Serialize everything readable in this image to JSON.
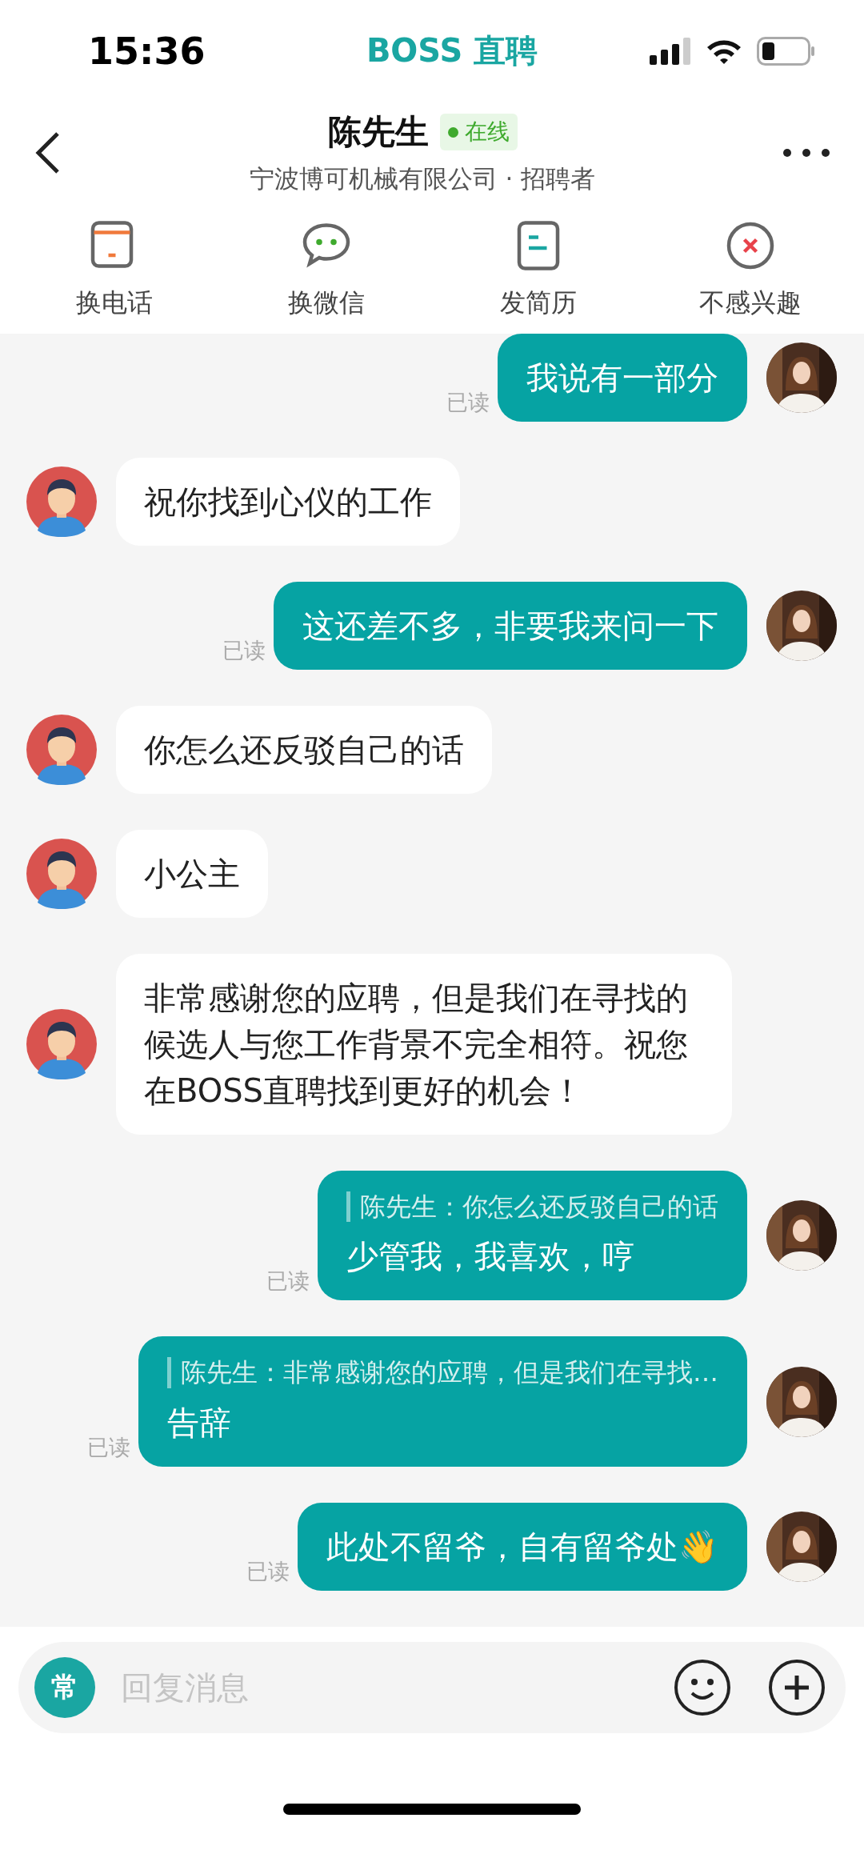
{
  "status_bar": {
    "time": "15:36",
    "app": "BOSS 直聘"
  },
  "header": {
    "name": "陈先生",
    "presence": {
      "label": "在线",
      "online": true
    },
    "subtitle": "宁波博可机械有限公司 · 招聘者"
  },
  "actions": [
    {
      "kind": "phone",
      "label": "换电话"
    },
    {
      "kind": "wechat",
      "label": "换微信"
    },
    {
      "kind": "resume",
      "label": "发简历"
    },
    {
      "kind": "reject",
      "label": "不感兴趣"
    }
  ],
  "messages": [
    {
      "kind": "sent",
      "text": "我说有一部分",
      "read": "已读"
    },
    {
      "kind": "received",
      "text": "祝你找到心仪的工作"
    },
    {
      "kind": "sent",
      "text": "这还差不多，非要我来问一下",
      "read": "已读"
    },
    {
      "kind": "received",
      "text": "你怎么还反驳自己的话"
    },
    {
      "kind": "received",
      "text": "小公主"
    },
    {
      "kind": "received",
      "text": "非常感谢您的应聘，但是我们在寻找的候选人与您工作背景不完全相符。祝您在BOSS直聘找到更好的机会！"
    },
    {
      "kind": "sent",
      "quote": "陈先生：你怎么还反驳自己的话",
      "text": "少管我，我喜欢，哼",
      "read": "已读"
    },
    {
      "kind": "sent",
      "quote": "陈先生：非常感谢您的应聘，但是我们在寻找…",
      "text": "告辞",
      "read": "已读"
    },
    {
      "kind": "sent",
      "text": "此处不留爷，自有留爷处👋",
      "read": "已读"
    }
  ],
  "composer": {
    "shortcut": "常",
    "placeholder": "回复消息"
  }
}
